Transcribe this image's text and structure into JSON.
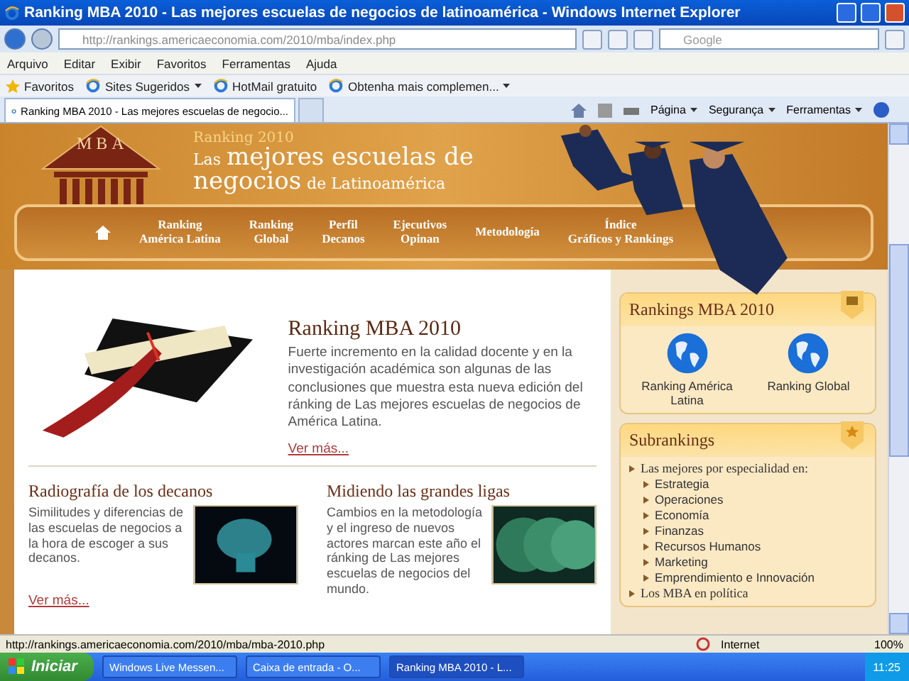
{
  "window": {
    "title": "Ranking MBA 2010 - Las mejores escuelas de negocios de latinoamérica - Windows Internet Explorer"
  },
  "address_bar": {
    "url": "http://rankings.americaeconomia.com/2010/mba/index.php",
    "search_placeholder": "Google"
  },
  "menu": [
    "Arquivo",
    "Editar",
    "Exibir",
    "Favoritos",
    "Ferramentas",
    "Ajuda"
  ],
  "favorites_bar": {
    "label": "Favoritos",
    "links": [
      {
        "label": "Sites Sugeridos",
        "dropdown": true
      },
      {
        "label": "HotMail gratuito",
        "dropdown": false
      },
      {
        "label": "Obtenha mais complemen...",
        "dropdown": true
      }
    ]
  },
  "tabs": [
    {
      "label": "Ranking MBA 2010 - Las mejores escuelas de negocio...",
      "selected": true
    }
  ],
  "command_bar": [
    "Página",
    "Segurança",
    "Ferramentas"
  ],
  "page": {
    "logo": "MBA",
    "kicker": "Ranking 2010",
    "title_small_1": "Las",
    "title_big_1": "mejores escuelas de",
    "title_big_2": "negocios",
    "title_small_2": "de Latinoamérica",
    "nav": [
      {
        "lines": [
          "Ranking",
          "América Latina"
        ]
      },
      {
        "lines": [
          "Ranking",
          "Global"
        ]
      },
      {
        "lines": [
          "Perfil",
          "Decanos"
        ]
      },
      {
        "lines": [
          "Ejecutivos",
          "Opinan"
        ]
      },
      {
        "lines": [
          "Metodología"
        ]
      },
      {
        "lines": [
          "Índice",
          "Gráficos y Rankings"
        ]
      }
    ],
    "feature": {
      "title": "Ranking MBA 2010",
      "text": "Fuerte incremento en la calidad docente y en la investigación académica son algunas de las conclusiones que muestra esta nueva edición del ránking de Las mejores escuelas de negocios de América Latina.",
      "link": "Ver más..."
    },
    "articles": [
      {
        "title": "Radiografía de los decanos",
        "text": "Similitudes y diferencias de las escuelas de negocios a la hora de escoger a sus decanos.",
        "link": "Ver más..."
      },
      {
        "title": "Midiendo las grandes ligas",
        "text": "Cambios en la metodología y el ingreso de nuevos actores marcan este año el ránking de Las mejores escuelas de negocios del mundo."
      }
    ],
    "sidebar": {
      "rankings": {
        "title": "Rankings MBA 2010",
        "items": [
          "Ranking América Latina",
          "Ranking Global"
        ]
      },
      "subrankings": {
        "title": "Subrankings",
        "group": "Las mejores por especialidad en:",
        "items": [
          "Estrategia",
          "Operaciones",
          "Economía",
          "Finanzas",
          "Recursos Humanos",
          "Marketing",
          "Emprendimiento e Innovación"
        ],
        "more": "Los MBA en política"
      }
    }
  },
  "status_bar": {
    "url": "http://rankings.americaeconomia.com/2010/mba/mba-2010.php",
    "zone": "Internet",
    "zoom": "100%"
  },
  "taskbar": {
    "start": "Iniciar",
    "tasks": [
      {
        "label": "Windows Live Messen...",
        "selected": false
      },
      {
        "label": "Caixa de entrada - O...",
        "selected": false
      },
      {
        "label": "Ranking MBA 2010 - L...",
        "selected": true
      }
    ],
    "clock": "11:25"
  }
}
